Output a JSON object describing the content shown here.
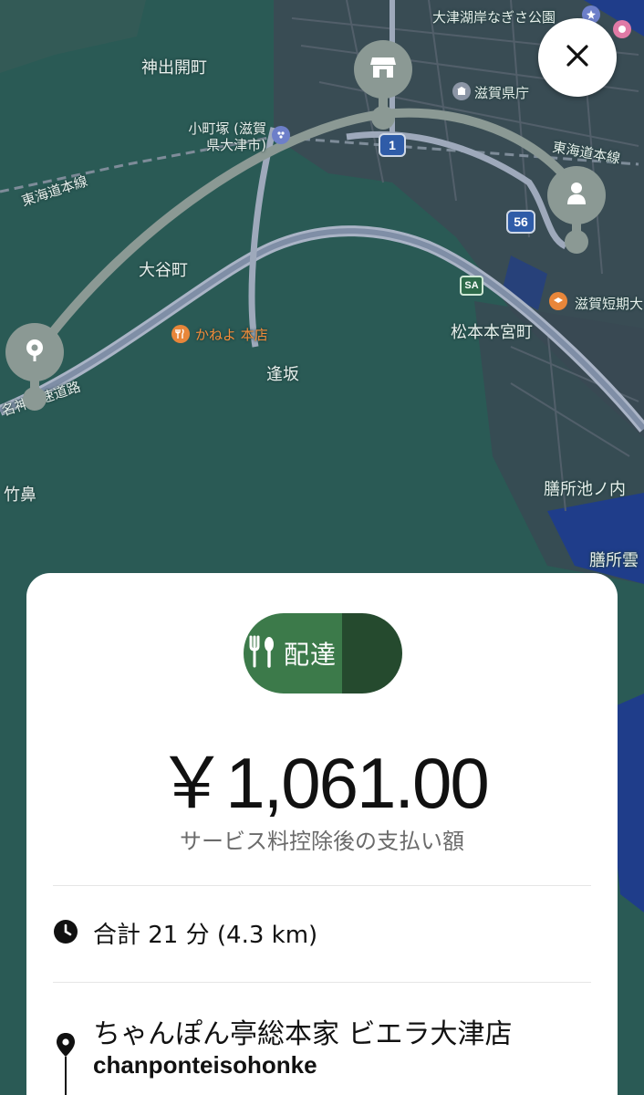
{
  "map": {
    "labels": {
      "jinde": "神出開町",
      "komachi": "小町塚 (滋賀\n県大津市)",
      "shigaken": "滋賀県庁",
      "otsu_park": "大津湖岸なぎさ公園",
      "tokaido_left": "東海道本線",
      "tokaido_right": "東海道本線",
      "otani": "大谷町",
      "kaneyo": "かねよ 本店",
      "osaka": "逢坂",
      "matsumoto": "松本本宮町",
      "shiga_tanki": "滋賀短期大",
      "zeze_ike": "膳所池ノ内",
      "zeze_un": "膳所雲",
      "takehana": "竹鼻",
      "meishin": "名神高速道路"
    },
    "route_badges": {
      "r1": "1",
      "r56": "56",
      "sa": "SA"
    },
    "colors": {
      "land": "#2a5a55",
      "water": "#1f3d8a",
      "road": "#8f9fb3",
      "route": "#8b9994"
    }
  },
  "close_button": {
    "icon": "close-icon"
  },
  "sheet": {
    "delivery_label": "配達",
    "amount": "￥1,061.00",
    "amount_caption": "サービス料控除後の支払い額",
    "trip_summary": "合計 21 分 (4.3 km)",
    "store_name": "ちゃんぽん亭総本家 ビエラ大津店",
    "store_sub": "chanponteisohonke",
    "accent_green": "#3c7a4a",
    "accent_dark": "#254a2e"
  }
}
